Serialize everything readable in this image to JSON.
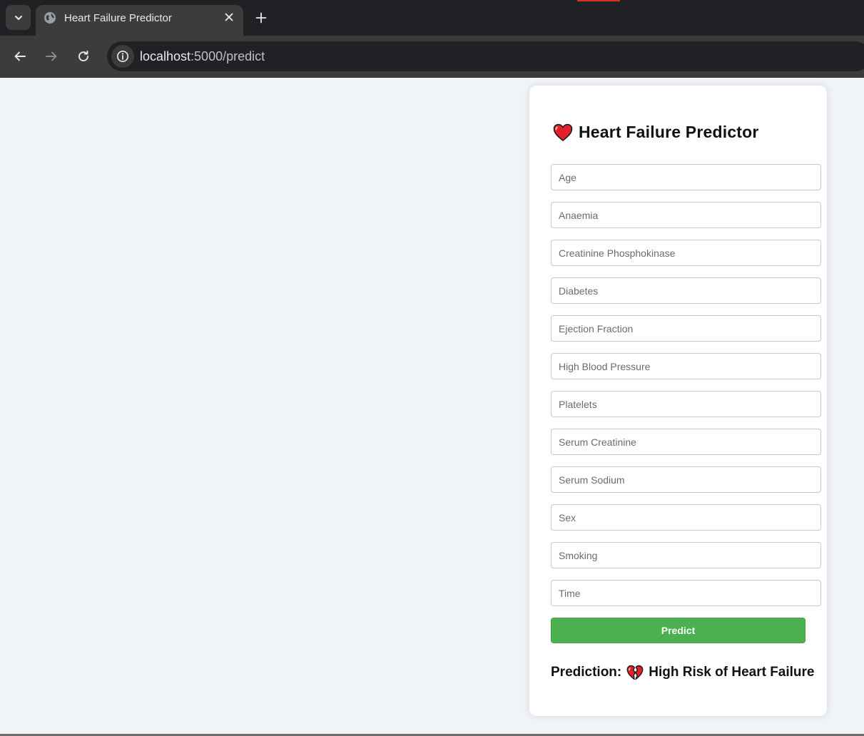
{
  "browser": {
    "tab_title": "Heart Failure Predictor",
    "url_host": "localhost",
    "url_path": ":5000/predict",
    "favicon_icon": "globe-icon"
  },
  "form": {
    "title": "Heart Failure Predictor",
    "title_icon": "red-heart-icon",
    "fields": [
      {
        "name": "age",
        "placeholder": "Age"
      },
      {
        "name": "anaemia",
        "placeholder": "Anaemia"
      },
      {
        "name": "creatinine_phosphokinase",
        "placeholder": "Creatinine Phosphokinase"
      },
      {
        "name": "diabetes",
        "placeholder": "Diabetes"
      },
      {
        "name": "ejection_fraction",
        "placeholder": "Ejection Fraction"
      },
      {
        "name": "high_blood_pressure",
        "placeholder": "High Blood Pressure"
      },
      {
        "name": "platelets",
        "placeholder": "Platelets"
      },
      {
        "name": "serum_creatinine",
        "placeholder": "Serum Creatinine"
      },
      {
        "name": "serum_sodium",
        "placeholder": "Serum Sodium"
      },
      {
        "name": "sex",
        "placeholder": "Sex"
      },
      {
        "name": "smoking",
        "placeholder": "Smoking"
      },
      {
        "name": "time",
        "placeholder": "Time"
      }
    ],
    "submit_label": "Predict"
  },
  "result": {
    "label": "Prediction:",
    "icon": "broken-heart-icon",
    "value": "High Risk of Heart Failure"
  },
  "colors": {
    "accent_button": "#4caf50",
    "heart": "#e2202b",
    "page_background": "#f0f4f8"
  }
}
